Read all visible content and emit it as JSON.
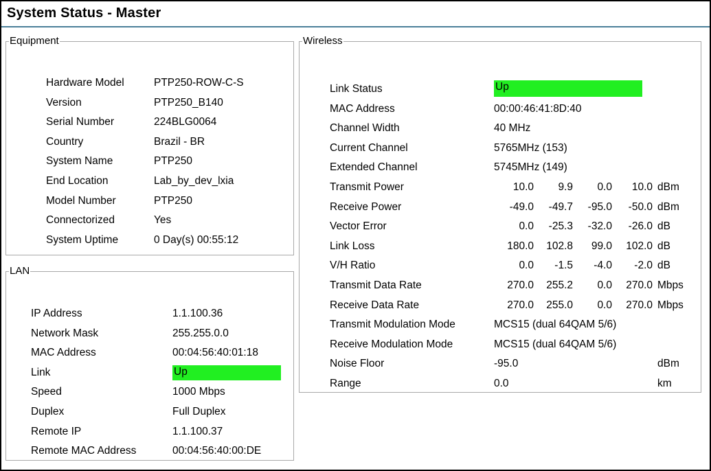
{
  "page": {
    "title": "System Status - Master"
  },
  "equipment": {
    "legend": "Equipment",
    "rows": [
      {
        "label": "Hardware Model",
        "value": "PTP250-ROW-C-S"
      },
      {
        "label": "Version",
        "value": "PTP250_B140"
      },
      {
        "label": "Serial Number",
        "value": "224BLG0064"
      },
      {
        "label": "Country",
        "value": "Brazil  - BR"
      },
      {
        "label": "System Name",
        "value": "PTP250"
      },
      {
        "label": "End Location",
        "value": "Lab_by_dev_lxia"
      },
      {
        "label": "Model Number",
        "value": "PTP250"
      },
      {
        "label": "Connectorized",
        "value": "Yes"
      },
      {
        "label": "System Uptime",
        "value": "0 Day(s) 00:55:12"
      }
    ]
  },
  "lan": {
    "legend": "LAN",
    "rows": [
      {
        "label": "IP Address",
        "value": "1.1.100.36"
      },
      {
        "label": "Network Mask",
        "value": "255.255.0.0"
      },
      {
        "label": "MAC Address",
        "value": "00:04:56:40:01:18"
      },
      {
        "label": "Link",
        "value": "Up"
      },
      {
        "label": "Speed",
        "value": "1000 Mbps"
      },
      {
        "label": "Duplex",
        "value": "Full Duplex"
      },
      {
        "label": "Remote IP",
        "value": "1.1.100.37"
      },
      {
        "label": "Remote MAC Address",
        "value": "00:04:56:40:00:DE"
      }
    ]
  },
  "wireless": {
    "legend": "Wireless",
    "link_status": {
      "label": "Link Status",
      "value": "Up"
    },
    "text_rows": [
      {
        "label": "MAC Address",
        "value": "00:00:46:41:8D:40"
      },
      {
        "label": "Channel Width",
        "value": "40 MHz"
      },
      {
        "label": "Current Channel",
        "value": "5765MHz (153)"
      },
      {
        "label": "Extended Channel",
        "value": "5745MHz (149)"
      }
    ],
    "metric_rows": [
      {
        "label": "Transmit Power",
        "v1": "10.0",
        "v2": "9.9",
        "v3": "0.0",
        "v4": "10.0",
        "unit": "dBm"
      },
      {
        "label": "Receive Power",
        "v1": "-49.0",
        "v2": "-49.7",
        "v3": "-95.0",
        "v4": "-50.0",
        "unit": "dBm"
      },
      {
        "label": "Vector Error",
        "v1": "0.0",
        "v2": "-25.3",
        "v3": "-32.0",
        "v4": "-26.0",
        "unit": "dB"
      },
      {
        "label": "Link Loss",
        "v1": "180.0",
        "v2": "102.8",
        "v3": "99.0",
        "v4": "102.0",
        "unit": "dB"
      },
      {
        "label": "V/H Ratio",
        "v1": "0.0",
        "v2": "-1.5",
        "v3": "-4.0",
        "v4": "-2.0",
        "unit": "dB"
      },
      {
        "label": "Transmit Data Rate",
        "v1": "270.0",
        "v2": "255.2",
        "v3": "0.0",
        "v4": "270.0",
        "unit": "Mbps"
      },
      {
        "label": "Receive Data Rate",
        "v1": "270.0",
        "v2": "255.0",
        "v3": "0.0",
        "v4": "270.0",
        "unit": "Mbps"
      }
    ],
    "mode_rows": [
      {
        "label": "Transmit Modulation Mode",
        "value": "MCS15 (dual 64QAM 5/6)"
      },
      {
        "label": "Receive Modulation Mode",
        "value": "MCS15 (dual 64QAM 5/6)"
      }
    ],
    "tail_rows": [
      {
        "label": "Noise Floor",
        "value": "-95.0",
        "unit": "dBm"
      },
      {
        "label": "Range",
        "value": "0.0",
        "unit": "km"
      }
    ]
  },
  "colors": {
    "link_up": "#21ef21",
    "title_rule": "#4a7f99",
    "fieldset_border": "#a8a8a8"
  }
}
